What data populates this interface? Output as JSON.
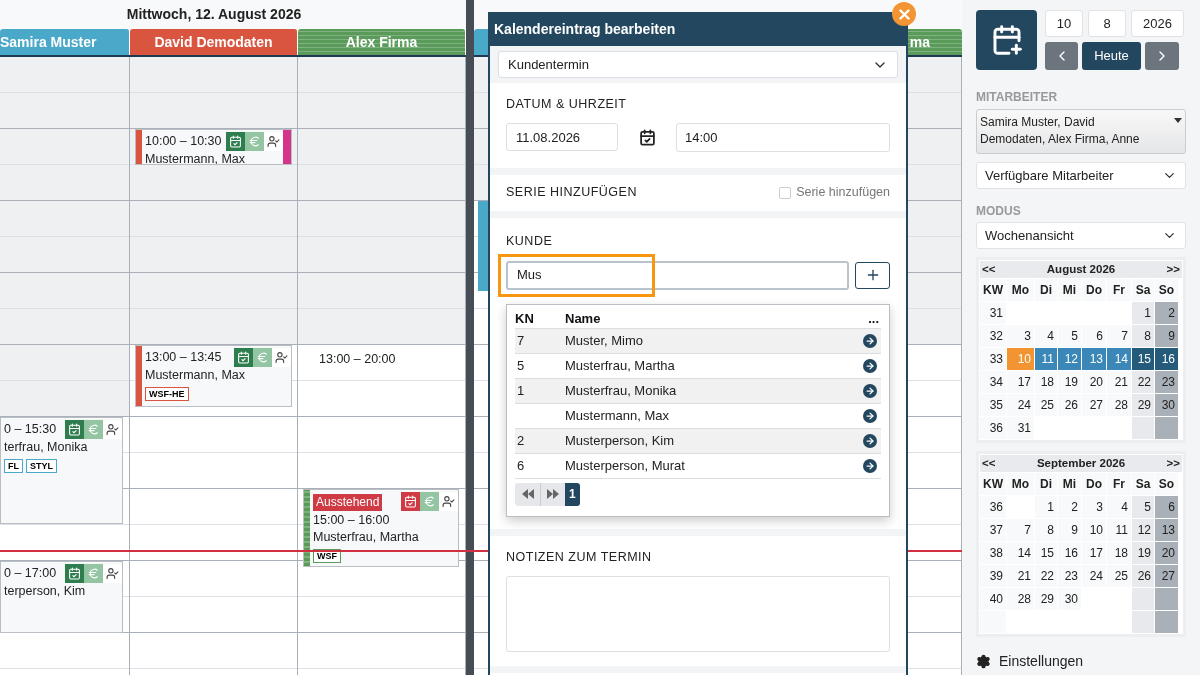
{
  "day": {
    "title": "Mittwoch, 12. August 2026",
    "staff": [
      {
        "name": "Samira Muster",
        "color": "#4aa8c8",
        "striped": false,
        "events": [
          {
            "time": "0 – 15:30",
            "customer": "terfrau, Monika",
            "tags": [
              "FL",
              "STYL"
            ],
            "bar": false,
            "pending": false
          },
          {
            "time": "0 – 17:00",
            "customer": "terperson, Kim",
            "bar": false,
            "pending": false
          }
        ]
      },
      {
        "name": "David Demodaten",
        "color": "#d9553f",
        "striped": false,
        "events": [
          {
            "time": "10:00 – 10:30",
            "customer": "Mustermann, Max",
            "bar": true,
            "pending": false,
            "color": "#d6338a"
          },
          {
            "time": "13:00 – 13:45",
            "customer": "Mustermann, Max",
            "tags": [
              "WSF-HE"
            ],
            "bar": true,
            "pending": false
          }
        ]
      },
      {
        "name": "Alex Firma",
        "color": "#5a9a5a",
        "striped": true,
        "availability": "13:00 – 20:00",
        "events": [
          {
            "status": "Ausstehend",
            "time": "15:00 – 16:00",
            "customer": "Musterfrau, Martha",
            "tags": [
              "WSF"
            ],
            "bar": true,
            "pending": true
          }
        ]
      }
    ]
  },
  "next_day": {
    "staff_header": "ma"
  },
  "dialog": {
    "title": "Kalendereintrag bearbeiten",
    "type_select": "Kundentermin",
    "date_section": {
      "label": "DATUM & UHRZEIT",
      "date": "11.08.2026",
      "time": "14:00"
    },
    "series": {
      "label": "SERIE HINZUFÜGEN",
      "checkbox_label": "Serie hinzufügen",
      "checked": false
    },
    "customer": {
      "label": "KUNDE",
      "value": "Mus",
      "highlighted": true,
      "results": {
        "columns": [
          "KN",
          "Name",
          "..."
        ],
        "rows": [
          {
            "kn": "7",
            "name": "Muster, Mimo"
          },
          {
            "kn": "5",
            "name": "Musterfrau, Martha"
          },
          {
            "kn": "1",
            "name": "Musterfrau, Monika"
          },
          {
            "kn": null,
            "name": "Mustermann, Max"
          },
          {
            "kn": "2",
            "name": "Musterperson, Kim"
          },
          {
            "kn": "6",
            "name": "Musterperson, Murat"
          }
        ],
        "page": "1"
      }
    },
    "notes": {
      "label": "NOTIZEN ZUM TERMIN"
    }
  },
  "sidebar": {
    "date_fields": [
      "10",
      "8",
      "2026"
    ],
    "today_button": "Heute",
    "staff_label": "MITARBEITER",
    "staff_select": "Samira Muster, David Demodaten, Alex Firma, Anne",
    "available_select": "Verfügbare Mitarbeiter",
    "mode_label": "MODUS",
    "mode_select": "Wochenansicht",
    "calendars": [
      {
        "title": "August 2026",
        "prev": "<<",
        "next": ">>",
        "headers": [
          "KW",
          "Mo",
          "Di",
          "Mi",
          "Do",
          "Fr",
          "Sa",
          "So"
        ],
        "weeks": [
          {
            "kw": "31",
            "selected": false,
            "kind": "late",
            "days": [
              "1",
              "2"
            ]
          },
          {
            "kw": "32",
            "selected": false,
            "kind": "full",
            "days": [
              "3",
              "4",
              "5",
              "6",
              "7",
              "8",
              "9"
            ]
          },
          {
            "kw": "33",
            "selected": true,
            "kind": "full",
            "days": [
              {
                "label": "10",
                "today": true
              },
              "11",
              "12",
              "13",
              "14",
              "15",
              "16"
            ]
          },
          {
            "kw": "34",
            "selected": false,
            "kind": "full",
            "days": [
              "17",
              "18",
              "19",
              "20",
              "21",
              "22",
              "23"
            ]
          },
          {
            "kw": "35",
            "selected": false,
            "kind": "full",
            "days": [
              "24",
              "25",
              "26",
              "27",
              "28",
              "29",
              "30"
            ]
          },
          {
            "kw": "36",
            "selected": false,
            "kind": "early",
            "days": [
              "31"
            ]
          }
        ]
      },
      {
        "title": "September 2026",
        "prev": "<<",
        "next": ">>",
        "headers": [
          "KW",
          "Mo",
          "Di",
          "Mi",
          "Do",
          "Fr",
          "Sa",
          "So"
        ],
        "weeks": [
          {
            "kw": "36",
            "selected": false,
            "kind": "late",
            "days": [
              "1",
              "2",
              "3",
              "4",
              "5",
              "6"
            ]
          },
          {
            "kw": "37",
            "selected": false,
            "kind": "full",
            "days": [
              "7",
              "8",
              "9",
              "10",
              "11",
              "12",
              "13"
            ]
          },
          {
            "kw": "38",
            "selected": false,
            "kind": "full",
            "days": [
              "14",
              "15",
              "16",
              "17",
              "18",
              "19",
              "20"
            ]
          },
          {
            "kw": "39",
            "selected": false,
            "kind": "full",
            "days": [
              "21",
              "22",
              "23",
              "24",
              "25",
              "26",
              "27"
            ]
          },
          {
            "kw": "40",
            "selected": false,
            "kind": "early",
            "days": [
              "28",
              "29",
              "30"
            ]
          }
        ]
      }
    ],
    "settings": "Einstellungen"
  }
}
